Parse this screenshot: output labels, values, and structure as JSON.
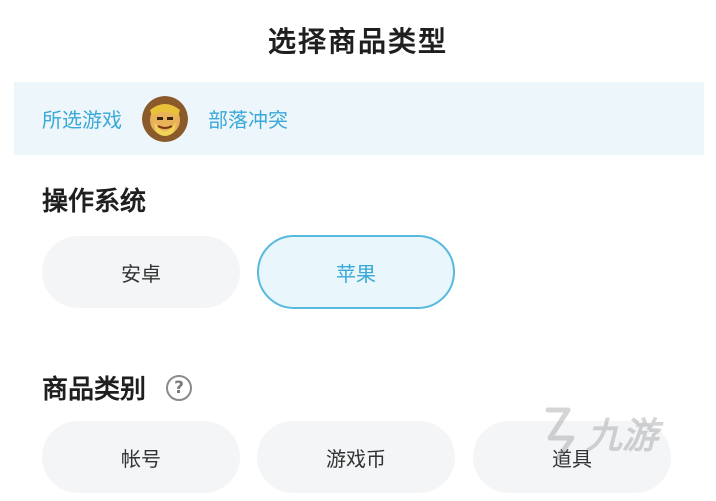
{
  "header": {
    "title": "选择商品类型"
  },
  "game": {
    "label": "所选游戏",
    "name": "部落冲突",
    "avatar_icon": "clash-of-clans-barbarian-icon"
  },
  "os_section": {
    "title": "操作系统",
    "options": [
      {
        "label": "安卓",
        "selected": false
      },
      {
        "label": "苹果",
        "selected": true
      }
    ]
  },
  "category_section": {
    "title": "商品类别",
    "help_glyph": "?",
    "options": [
      {
        "label": "帐号"
      },
      {
        "label": "游戏币"
      },
      {
        "label": "道具"
      }
    ]
  },
  "watermark": {
    "text": "九游",
    "icon": "jiuyou-logo"
  },
  "colors": {
    "accent": "#3aa8d8",
    "selected_bg": "#e9f6fb",
    "option_bg": "#f3f5f7",
    "banner_bg": "#edf7fb"
  }
}
